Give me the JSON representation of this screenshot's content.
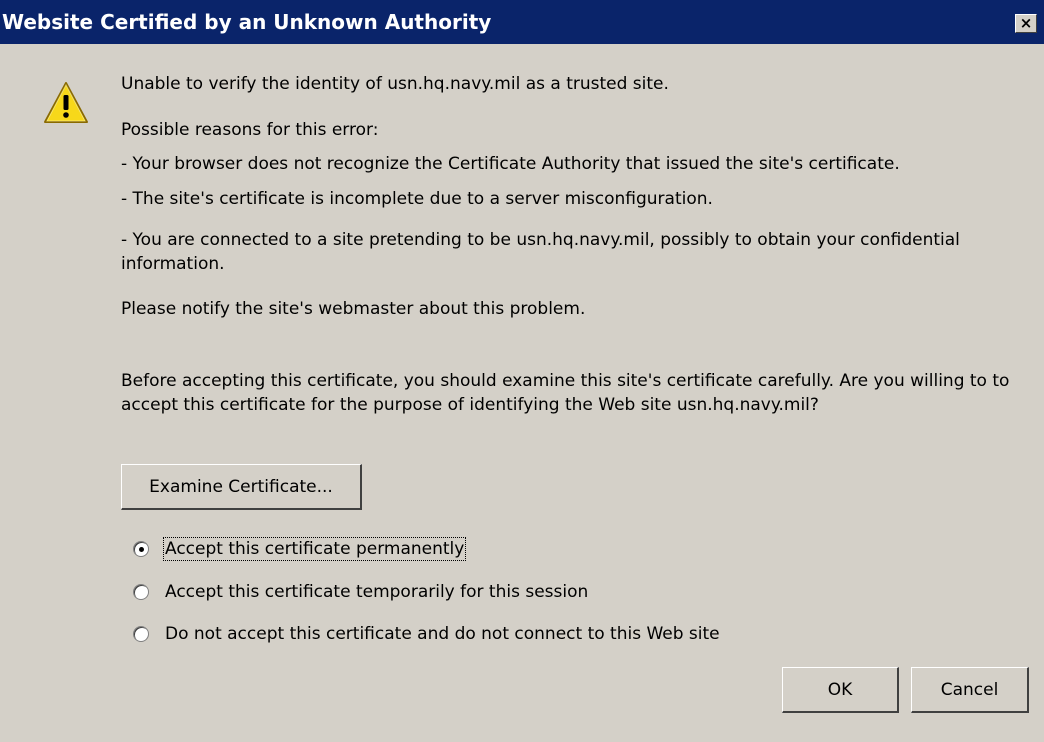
{
  "window": {
    "title": "Website Certified by an Unknown Authority",
    "close_glyph": "×"
  },
  "message": {
    "line1": "Unable to verify the identity of usn.hq.navy.mil as a trusted site.",
    "reasons_header": "Possible reasons for this error:",
    "reason1": "- Your browser does not recognize the Certificate Authority that issued the site's certificate.",
    "reason2": "- The site's certificate is incomplete due to a server misconfiguration.",
    "reason3": "- You are connected to a site pretending to be usn.hq.navy.mil, possibly to obtain your confidential information.",
    "notify": "Please notify the site's webmaster about this problem.",
    "before": "Before accepting this certificate, you should examine this site's certificate carefully. Are you willing to to accept this certificate for the purpose of identifying the Web site usn.hq.navy.mil?"
  },
  "buttons": {
    "examine": "Examine Certificate...",
    "ok": "OK",
    "cancel": "Cancel"
  },
  "options": [
    {
      "label": "Accept this certificate permanently",
      "selected": true
    },
    {
      "label": "Accept this certificate temporarily for this session",
      "selected": false
    },
    {
      "label": "Do not accept this certificate and do not connect to this Web site",
      "selected": false
    }
  ],
  "icons": {
    "warning": "warning-icon",
    "close": "close-icon"
  },
  "colors": {
    "titlebar": "#0a246a",
    "dialog_bg": "#d4d0c8",
    "warning_fill": "#f7d81a"
  }
}
